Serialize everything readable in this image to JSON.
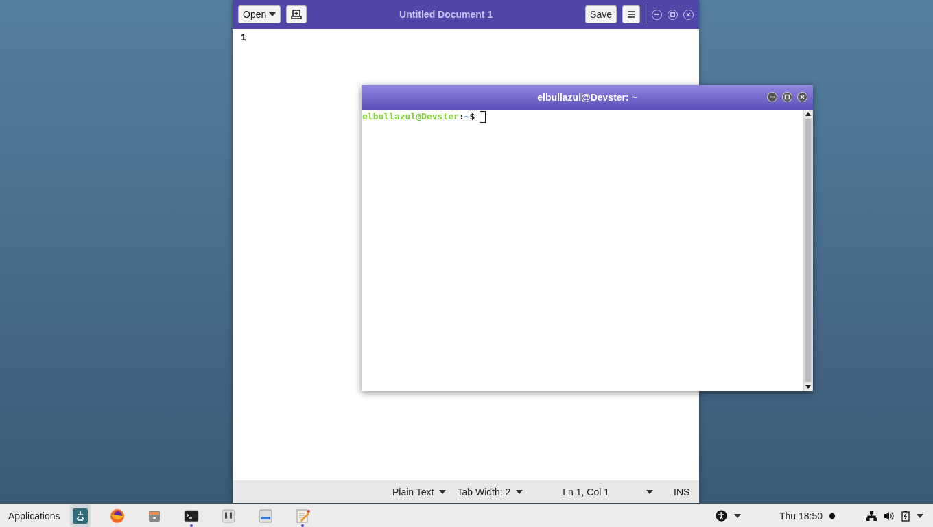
{
  "editor": {
    "title": "Untitled Document 1",
    "open_button": "Open",
    "save_button": "Save",
    "line_numbers": [
      "1"
    ],
    "status_bar": {
      "language": "Plain Text",
      "tab_width": "Tab Width: 2",
      "position": "Ln 1, Col 1",
      "mode": "INS"
    }
  },
  "terminal": {
    "title": "elbullazul@Devster: ~",
    "prompt_user": "elbullazul@Devster",
    "prompt_sep": ":",
    "prompt_path": "~",
    "prompt_symbol": "$"
  },
  "taskbar": {
    "applications": "Applications",
    "apps": [
      {
        "selected": true,
        "running": false
      },
      {
        "selected": false,
        "running": false
      },
      {
        "selected": false,
        "running": false
      },
      {
        "selected": false,
        "running": true
      },
      {
        "selected": false,
        "running": false
      },
      {
        "selected": false,
        "running": false
      },
      {
        "selected": false,
        "running": true
      }
    ],
    "clock": "Thu 18:50"
  }
}
